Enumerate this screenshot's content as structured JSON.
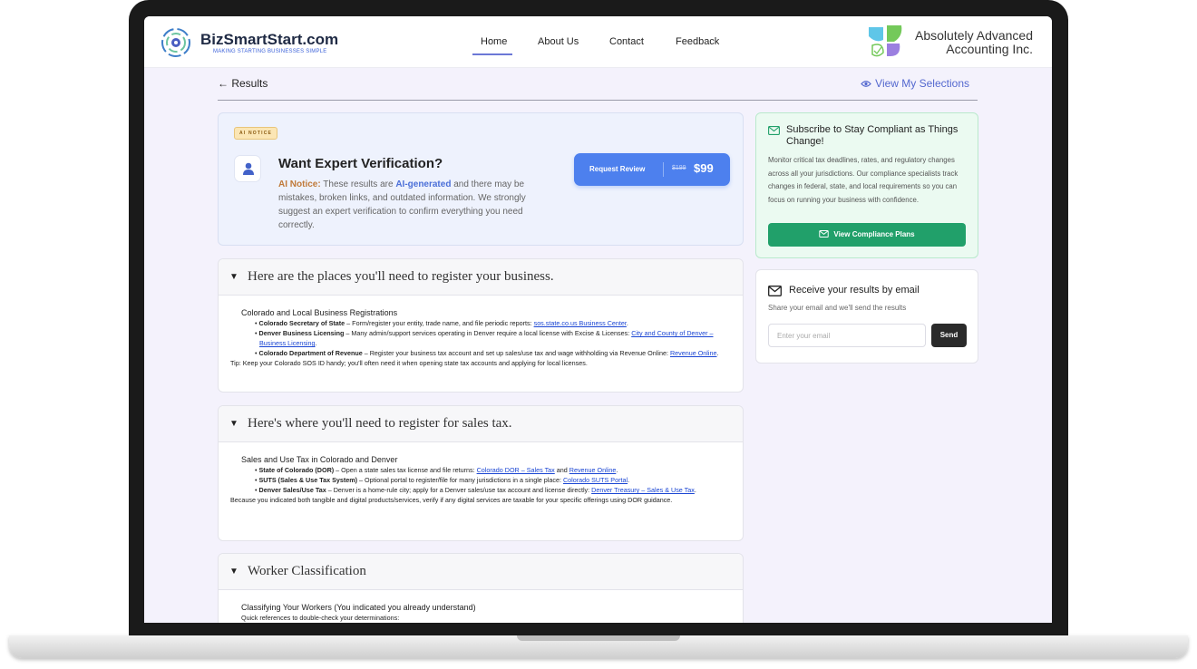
{
  "header": {
    "brand_title": "BizSmartStart.com",
    "brand_tagline": "MAKING STARTING BUSINESSES SIMPLE",
    "nav": [
      "Home",
      "About Us",
      "Contact",
      "Feedback"
    ],
    "partner_line1": "Absolutely Advanced",
    "partner_line2": "Accounting Inc."
  },
  "results_bar": {
    "back_label": "Results",
    "view_selections": "View My Selections"
  },
  "ai_notice": {
    "badge": "AI NOTICE",
    "title": "Want Expert Verification?",
    "notice_label": "AI Notice:",
    "text_before": " These results are ",
    "ai_generated": "AI-generated",
    "text_after": " and there may be mistakes, broken links, and outdated information. We strongly suggest an expert verification to confirm everything you need correctly.",
    "button_label": "Request Review",
    "old_price": "$199",
    "new_price": "$99"
  },
  "sections": {
    "register": {
      "title": "Here are the places you'll need to register your business.",
      "heading": "Colorado and Local Business Registrations",
      "b1_name": "Colorado Secretary of State",
      "b1_text": " – Form/register your entity, trade name, and file periodic reports: ",
      "b1_link": "sos.state.co.us Business Center",
      "b2_name": "Denver Business Licensing",
      "b2_text": " – Many admin/support services operating in Denver require a local license with Excise & Licenses: ",
      "b2_link": "City and County of Denver – Business Licensing",
      "b3_name": "Colorado Department of Revenue",
      "b3_text": " – Register your business tax account and set up sales/use tax and wage withholding via Revenue Online: ",
      "b3_link": "Revenue Online",
      "tip": "Tip: Keep your Colorado SOS ID handy; you'll often need it when opening state tax accounts and applying for local licenses."
    },
    "sales_tax": {
      "title": "Here's where you'll need to register for sales tax.",
      "heading": "Sales and Use Tax in Colorado and Denver",
      "b1_name": "State of Colorado (DOR)",
      "b1_text": " – Open a state sales tax license and file returns: ",
      "b1_link1": "Colorado DOR – Sales Tax",
      "b1_and": " and ",
      "b1_link2": "Revenue Online",
      "b2_name": "SUTS (Sales & Use Tax System)",
      "b2_text": " – Optional portal to register/file for many jurisdictions in a single place: ",
      "b2_link": "Colorado SUTS Portal",
      "b3_name": "Denver Sales/Use Tax",
      "b3_text": " – Denver is a home-rule city; apply for a Denver sales/use tax account and license directly: ",
      "b3_link": "Denver Treasury – Sales & Use Tax",
      "note": "Because you indicated both tangible and digital products/services, verify if any digital services are taxable for your specific offerings using DOR guidance."
    },
    "workers": {
      "title": "Worker Classification",
      "heading": "Classifying Your Workers (You indicated you already understand)",
      "sub": "Quick references to double-check your determinations:"
    }
  },
  "subscribe": {
    "title": "Subscribe to Stay Compliant as Things Change!",
    "text": "Monitor critical tax deadlines, rates, and regulatory changes across all your jurisdictions. Our compliance specialists track changes in federal, state, and local requirements so you can focus on running your business with confidence.",
    "button": "View Compliance Plans"
  },
  "email_box": {
    "title": "Receive your results by email",
    "subtitle": "Share your email and we'll send the results",
    "placeholder": "Enter your email",
    "send": "Send"
  }
}
